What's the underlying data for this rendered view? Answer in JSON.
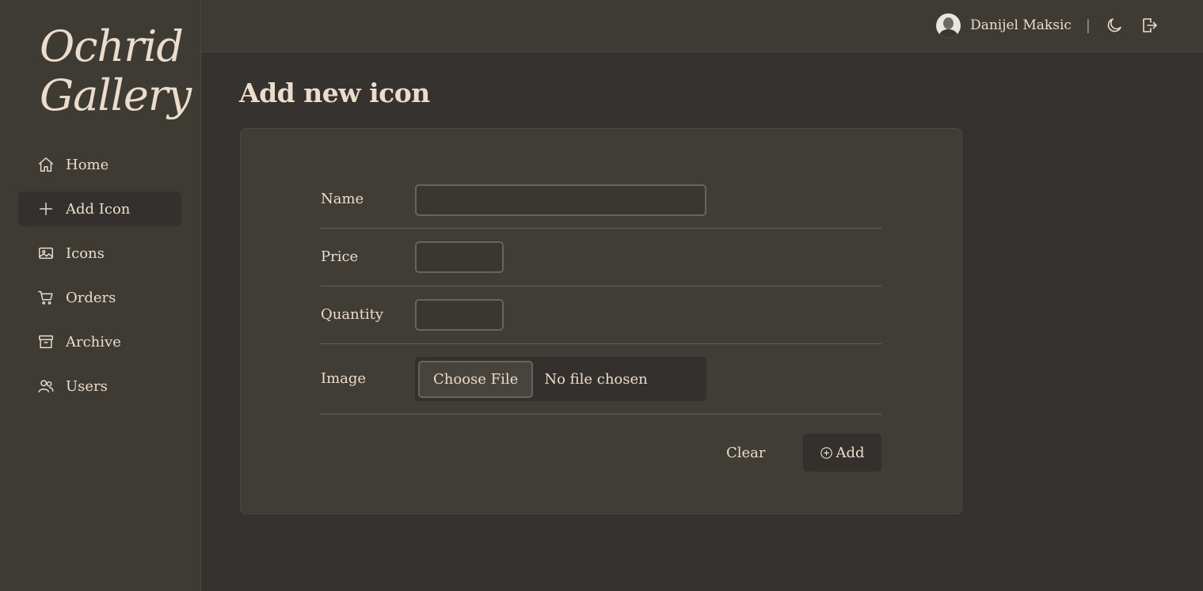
{
  "app": {
    "logo_line1": "Ochrid",
    "logo_line2": "Gallery"
  },
  "sidebar": {
    "items": [
      {
        "label": "Home",
        "icon": "home-icon",
        "active": false
      },
      {
        "label": "Add Icon",
        "icon": "plus-icon",
        "active": true
      },
      {
        "label": "Icons",
        "icon": "image-icon",
        "active": false
      },
      {
        "label": "Orders",
        "icon": "cart-icon",
        "active": false
      },
      {
        "label": "Archive",
        "icon": "archive-icon",
        "active": false
      },
      {
        "label": "Users",
        "icon": "users-icon",
        "active": false
      }
    ]
  },
  "header": {
    "username": "Danijel Maksic",
    "separator": "|",
    "icons": [
      "avatar",
      "moon-icon",
      "logout-icon"
    ]
  },
  "main": {
    "title": "Add new icon",
    "form": {
      "name_label": "Name",
      "name_value": "",
      "price_label": "Price",
      "price_value": "",
      "quantity_label": "Quantity",
      "quantity_value": "",
      "image_label": "Image",
      "choose_file_label": "Choose File",
      "file_status": "No file chosen"
    },
    "actions": {
      "clear_label": "Clear",
      "add_label": "Add"
    }
  },
  "colors": {
    "background": "#353230",
    "sidebar": "#3e3b35",
    "card": "#403d36",
    "text": "#ebdccb",
    "active_item": "#33302d"
  }
}
